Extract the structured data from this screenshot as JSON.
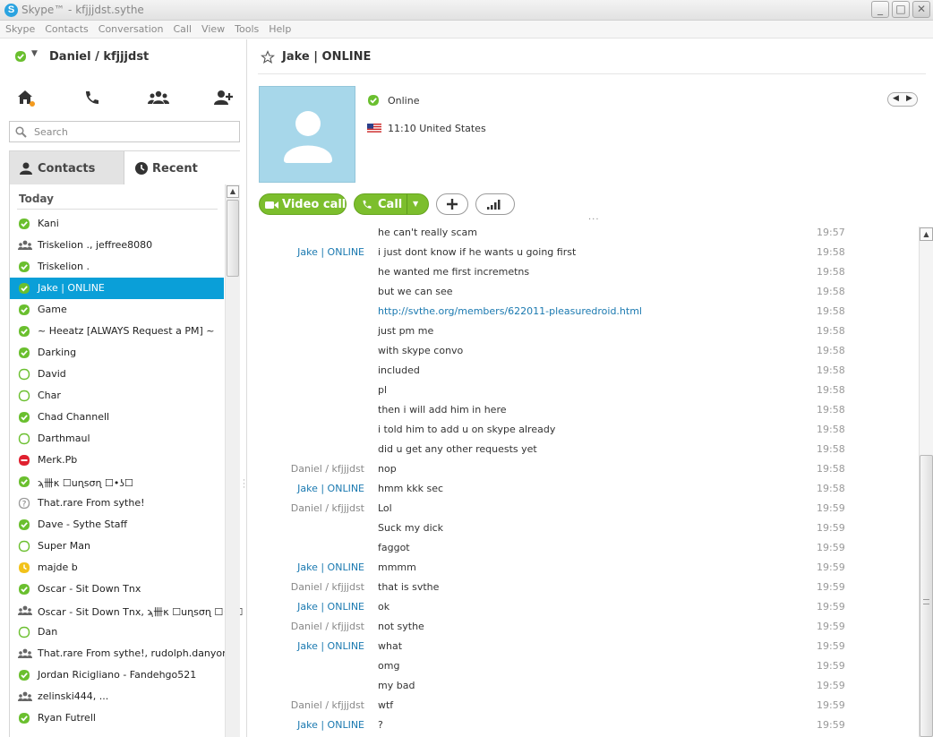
{
  "window": {
    "title": "Skype™ - kfjjjdst.sythe",
    "logo_letter": "S",
    "controls": [
      "_",
      "□",
      "✕"
    ]
  },
  "menu": [
    "Skype",
    "Contacts",
    "Conversation",
    "Call",
    "View",
    "Tools",
    "Help"
  ],
  "left": {
    "user_display": "Daniel / kfjjjdst",
    "icons": [
      "home-icon",
      "phone-icon",
      "group-icon",
      "add-contact-icon"
    ],
    "search_placeholder": "Search",
    "tabs": [
      {
        "label": "Contacts",
        "icon": "person-icon",
        "active": true
      },
      {
        "label": "Recent",
        "icon": "clock-icon",
        "active": false
      }
    ],
    "group_header": "Today",
    "contacts": [
      {
        "name": "Kani",
        "status": "online"
      },
      {
        "name": "Triskelion ., jeffree8080",
        "status": "group"
      },
      {
        "name": "Triskelion .",
        "status": "online"
      },
      {
        "name": "Jake | ONLINE",
        "status": "online",
        "selected": true
      },
      {
        "name": "Game",
        "status": "online"
      },
      {
        "name": "~ Heeatz [ALWAYS Request a PM] ~",
        "status": "online"
      },
      {
        "name": "Darking",
        "status": "online"
      },
      {
        "name": "David",
        "status": "offline"
      },
      {
        "name": "Char",
        "status": "offline"
      },
      {
        "name": "Chad Channell",
        "status": "online"
      },
      {
        "name": "Darthmaul",
        "status": "offline"
      },
      {
        "name": "Merk.Pb",
        "status": "busy"
      },
      {
        "name": "ϡ卌κ ☐uɳsσɳ ☐•ʖ☐",
        "status": "online"
      },
      {
        "name": "That.rare From sythe!",
        "status": "unknown"
      },
      {
        "name": "Dave - Sythe Staff",
        "status": "online"
      },
      {
        "name": "Super Man",
        "status": "offline"
      },
      {
        "name": "majde  b",
        "status": "away"
      },
      {
        "name": "Oscar - Sit Down Tnx",
        "status": "online"
      },
      {
        "name": "Oscar - Sit Down Tnx, ϡ卌κ ☐uɳsσɳ ☐•ʖ☐",
        "status": "group"
      },
      {
        "name": "Dan",
        "status": "offline"
      },
      {
        "name": "That.rare From sythe!, rudolph.danyon",
        "status": "group"
      },
      {
        "name": "Jordan Ricigliano - Fandehgo521",
        "status": "online"
      },
      {
        "name": "zelinski444, ...",
        "status": "group"
      },
      {
        "name": "Ryan Futrell",
        "status": "online"
      }
    ]
  },
  "chat": {
    "contact_name": "Jake | ONLINE",
    "status_text": "Online",
    "local_time": "11:10 United States",
    "buttons": {
      "video": "Video call",
      "call": "Call"
    },
    "messages": [
      {
        "sender": "",
        "text": "he can't really scam",
        "time": "19:57"
      },
      {
        "sender": "Jake | ONLINE",
        "text": "i just dont know if he wants u going first",
        "time": "19:58"
      },
      {
        "sender": "",
        "text": "he wanted me first incremetns",
        "time": "19:58"
      },
      {
        "sender": "",
        "text": "but we can see",
        "time": "19:58"
      },
      {
        "sender": "",
        "text": "http://svthe.org/members/622011-pleasuredroid.html",
        "time": "19:58",
        "link": true
      },
      {
        "sender": "",
        "text": "just pm me",
        "time": "19:58"
      },
      {
        "sender": "",
        "text": "with skype convo",
        "time": "19:58"
      },
      {
        "sender": "",
        "text": "included",
        "time": "19:58"
      },
      {
        "sender": "",
        "text": "pl",
        "time": "19:58"
      },
      {
        "sender": "",
        "text": "then i will add him in here",
        "time": "19:58"
      },
      {
        "sender": "",
        "text": "i told him to add u on skype already",
        "time": "19:58"
      },
      {
        "sender": "",
        "text": "did u get any other requests yet",
        "time": "19:58"
      },
      {
        "sender": "Daniel / kfjjjdst",
        "text": "nop",
        "time": "19:58"
      },
      {
        "sender": "Jake | ONLINE",
        "text": "hmm kkk sec",
        "time": "19:58"
      },
      {
        "sender": "Daniel / kfjjjdst",
        "text": "Lol",
        "time": "19:59"
      },
      {
        "sender": "",
        "text": "Suck my dick",
        "time": "19:59"
      },
      {
        "sender": "",
        "text": "faggot",
        "time": "19:59"
      },
      {
        "sender": "Jake | ONLINE",
        "text": "mmmm",
        "time": "19:59"
      },
      {
        "sender": "Daniel / kfjjjdst",
        "text": "that is svthe",
        "time": "19:59"
      },
      {
        "sender": "Jake | ONLINE",
        "text": "ok",
        "time": "19:59"
      },
      {
        "sender": "Daniel / kfjjjdst",
        "text": "not sythe",
        "time": "19:59"
      },
      {
        "sender": "Jake | ONLINE",
        "text": "what",
        "time": "19:59"
      },
      {
        "sender": "",
        "text": "omg",
        "time": "19:59"
      },
      {
        "sender": "",
        "text": "my bad",
        "time": "19:59"
      },
      {
        "sender": "Daniel / kfjjjdst",
        "text": "wtf",
        "time": "19:59"
      },
      {
        "sender": "Jake | ONLINE",
        "text": "?",
        "time": "19:59"
      }
    ]
  },
  "colors": {
    "online": "#6abf2e",
    "busy": "#e0202f",
    "away": "#f2c21a",
    "selection": "#0a9fd8",
    "link": "#1a79b0",
    "avatar_bg": "#a7d7ea"
  }
}
